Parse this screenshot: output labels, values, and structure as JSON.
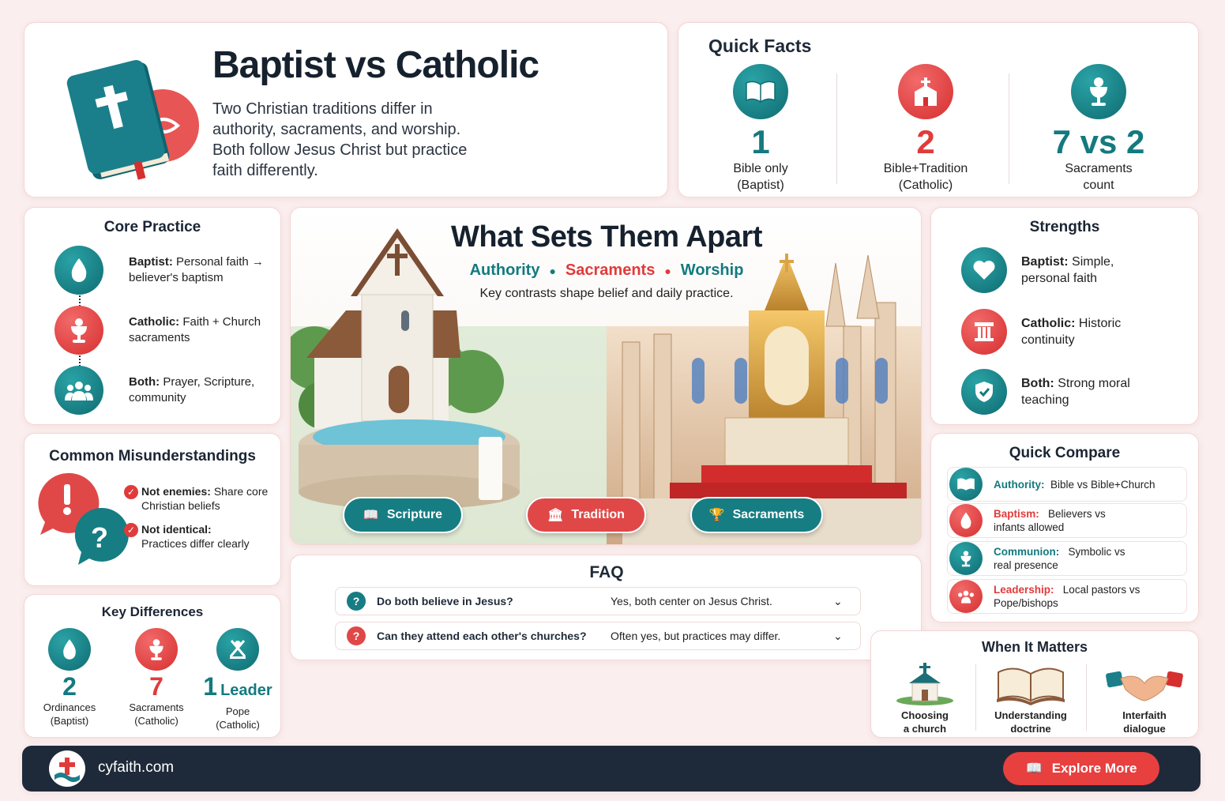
{
  "header": {
    "title": "Baptist vs Catholic",
    "description": "Two Christian traditions differ in authority, sacraments, and worship. Both follow Jesus Christ but practice faith differently."
  },
  "quick_facts": {
    "title": "Quick Facts",
    "items": [
      {
        "value": "1",
        "label_line1": "Bible only",
        "label_line2": "(Baptist)",
        "icon": "book-icon",
        "color": "#137a7f"
      },
      {
        "value": "2",
        "label_line1": "Bible+Tradition",
        "label_line2": "(Catholic)",
        "icon": "church-icon",
        "color": "#e03b3b"
      },
      {
        "value": "7 vs 2",
        "label_line1": "Sacraments",
        "label_line2": "count",
        "icon": "chalice-icon",
        "color": "#137a7f"
      }
    ]
  },
  "core_practice": {
    "title": "Core Practice",
    "items": [
      {
        "label": "Baptist:",
        "text": "Personal faith → believer's baptism",
        "icon": "water-drop-icon"
      },
      {
        "label": "Catholic:",
        "text": "Faith + Church sacraments",
        "icon": "chalice-icon"
      },
      {
        "label": "Both:",
        "text": "Prayer, Scripture, community",
        "icon": "people-icon"
      }
    ]
  },
  "misunderstandings": {
    "title": "Common Misunderstandings",
    "items": [
      {
        "label": "Not enemies:",
        "text": "Share core Christian beliefs"
      },
      {
        "label": "Not identical:",
        "text": "Practices differ clearly"
      }
    ]
  },
  "key_differences": {
    "title": "Key Differences",
    "items": [
      {
        "value": "2",
        "suffix": "",
        "label_line1": "Ordinances",
        "label_line2": "(Baptist)",
        "icon": "water-drop-icon"
      },
      {
        "value": "7",
        "suffix": "",
        "label_line1": "Sacraments",
        "label_line2": "(Catholic)",
        "icon": "chalice-icon"
      },
      {
        "value": "1",
        "suffix": "Leader",
        "label_line1": "Pope",
        "label_line2": "(Catholic)",
        "icon": "papal-keys-icon"
      }
    ]
  },
  "sets_apart": {
    "title": "What Sets Them Apart",
    "tags": [
      "Authority",
      "Sacraments",
      "Worship"
    ],
    "subtitle": "Key contrasts shape belief and daily practice.",
    "pills": [
      "Scripture",
      "Tradition",
      "Sacraments"
    ]
  },
  "faq": {
    "title": "FAQ",
    "items": [
      {
        "q": "Do both believe in Jesus?",
        "a": "Yes, both center on Jesus Christ."
      },
      {
        "q": "Can they attend each other's churches?",
        "a": "Often yes, but practices may differ."
      }
    ]
  },
  "strengths": {
    "title": "Strengths",
    "items": [
      {
        "label": "Baptist:",
        "text": "Simple, personal faith",
        "icon": "heart-icon"
      },
      {
        "label": "Catholic:",
        "text": "Historic continuity",
        "icon": "pillar-icon"
      },
      {
        "label": "Both:",
        "text": "Strong moral teaching",
        "icon": "shield-check-icon"
      }
    ]
  },
  "quick_compare": {
    "title": "Quick Compare",
    "items": [
      {
        "label": "Authority:",
        "text": "Bible vs Bible+Church"
      },
      {
        "label": "Baptism:",
        "text": "Believers vs infants allowed"
      },
      {
        "label": "Communion:",
        "text": "Symbolic vs real presence"
      },
      {
        "label": "Leadership:",
        "text": "Local pastors vs Pope/bishops"
      }
    ]
  },
  "when_it_matters": {
    "title": "When It Matters",
    "items": [
      {
        "line1": "Choosing",
        "line2": "a church",
        "icon": "church-icon"
      },
      {
        "line1": "Understanding",
        "line2": "doctrine",
        "icon": "open-book-icon"
      },
      {
        "line1": "Interfaith",
        "line2": "dialogue",
        "icon": "handshake-icon"
      }
    ]
  },
  "footer": {
    "site": "cyfaith.com",
    "cta": "Explore More"
  },
  "colors": {
    "teal": "#137a7f",
    "red": "#e03b3b",
    "navy": "#1e2a3a",
    "background": "#fbeeee"
  }
}
